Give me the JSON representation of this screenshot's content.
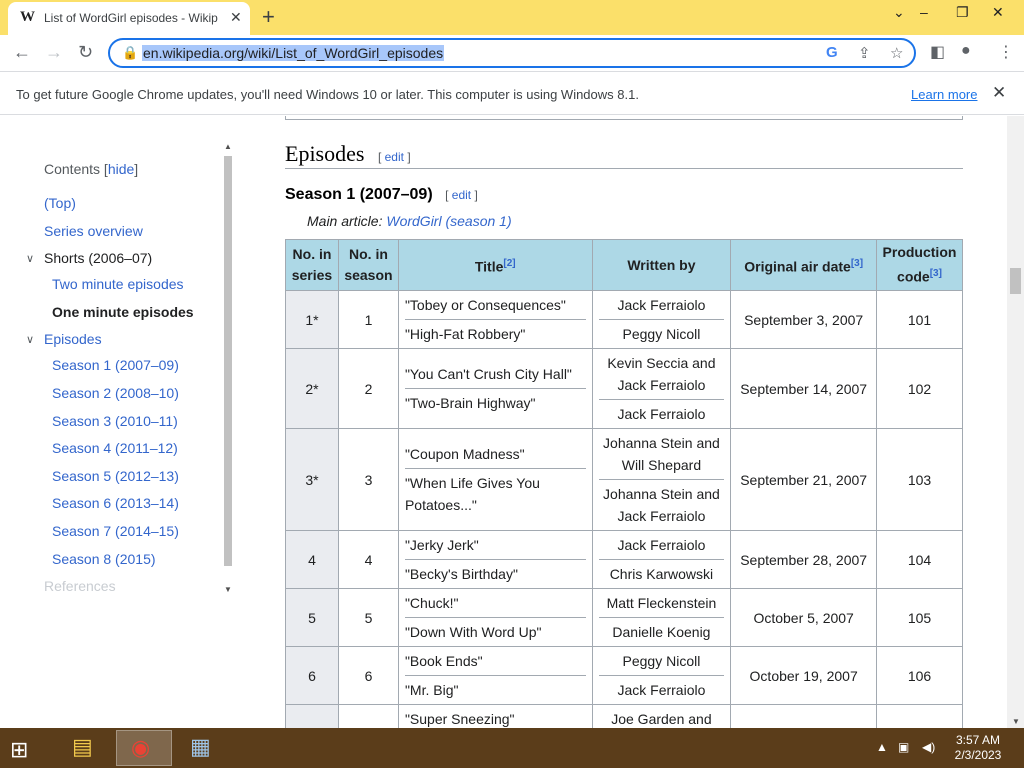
{
  "browser": {
    "tab_title": "List of WordGirl episodes - Wikip",
    "tab_favicon": "W",
    "url": "en.wikipedia.org/wiki/List_of_WordGirl_episodes",
    "accent": "#1a73e8",
    "tabstrip_color": "#fbe06a"
  },
  "infobar": {
    "message": "To get future Google Chrome updates, you'll need Windows 10 or later. This computer is using Windows 8.1.",
    "link": "Learn more"
  },
  "toc": {
    "title": "Contents",
    "hide": "hide",
    "items": [
      {
        "label": "(Top)"
      },
      {
        "label": "Series overview"
      },
      {
        "label": "Shorts (2006–07)"
      },
      {
        "label": "Two minute episodes"
      },
      {
        "label": "One minute episodes"
      },
      {
        "label": "Episodes"
      },
      {
        "label": "Season 1 (2007–09)"
      },
      {
        "label": "Season 2 (2008–10)"
      },
      {
        "label": "Season 3 (2010–11)"
      },
      {
        "label": "Season 4 (2011–12)"
      },
      {
        "label": "Season 5 (2012–13)"
      },
      {
        "label": "Season 6 (2013–14)"
      },
      {
        "label": "Season 7 (2014–15)"
      },
      {
        "label": "Season 8 (2015)"
      },
      {
        "label": "References"
      }
    ]
  },
  "article": {
    "section_title": "Episodes",
    "edit": "edit",
    "subsection_title": "Season 1 (2007–09)",
    "main_article_prefix": "Main article: ",
    "main_article_link": "WordGirl (season 1)",
    "headers": {
      "no_series": "No. in series",
      "no_season": "No. in season",
      "title": "Title",
      "title_ref": "[2]",
      "written_by": "Written by",
      "air_date": "Original air date",
      "air_date_ref": "[3]",
      "prod_code": "Production code",
      "prod_code_ref": "[3]"
    },
    "rows": [
      {
        "series": "1*",
        "season": "1",
        "titles": [
          "\"Tobey or Consequences\"",
          "\"High-Fat Robbery\""
        ],
        "writers": [
          "Jack Ferraiolo",
          "Peggy Nicoll"
        ],
        "date": "September 3, 2007",
        "code": "101"
      },
      {
        "series": "2*",
        "season": "2",
        "titles": [
          "\"You Can't Crush City Hall\"",
          "\"Two-Brain Highway\""
        ],
        "writers": [
          "Kevin Seccia and Jack Ferraiolo",
          "Jack Ferraiolo"
        ],
        "date": "September 14, 2007",
        "code": "102"
      },
      {
        "series": "3*",
        "season": "3",
        "titles": [
          "\"Coupon Madness\"",
          "\"When Life Gives You Potatoes...\""
        ],
        "writers": [
          "Johanna Stein and Will Shepard",
          "Johanna Stein and Jack Ferraiolo"
        ],
        "date": "September 21, 2007",
        "code": "103"
      },
      {
        "series": "4",
        "season": "4",
        "titles": [
          "\"Jerky Jerk\"",
          "\"Becky's Birthday\""
        ],
        "writers": [
          "Jack Ferraiolo",
          "Chris Karwowski"
        ],
        "date": "September 28, 2007",
        "code": "104"
      },
      {
        "series": "5",
        "season": "5",
        "titles": [
          "\"Chuck!\"",
          "\"Down With Word Up\""
        ],
        "writers": [
          "Matt Fleckenstein",
          "Danielle Koenig"
        ],
        "date": "October 5, 2007",
        "code": "105"
      },
      {
        "series": "6",
        "season": "6",
        "titles": [
          "\"Book Ends\"",
          "\"Mr. Big\""
        ],
        "writers": [
          "Peggy Nicoll",
          "Jack Ferraiolo"
        ],
        "date": "October 19, 2007",
        "code": "106"
      },
      {
        "series": "",
        "season": "",
        "titles": [
          "\"Super Sneezing\"",
          ""
        ],
        "writers": [
          "Joe Garden and",
          ""
        ],
        "date": "",
        "code": ""
      }
    ]
  },
  "taskbar": {
    "time": "3:57 AM",
    "date": "2/3/2023",
    "color": "#5b3d1a"
  }
}
